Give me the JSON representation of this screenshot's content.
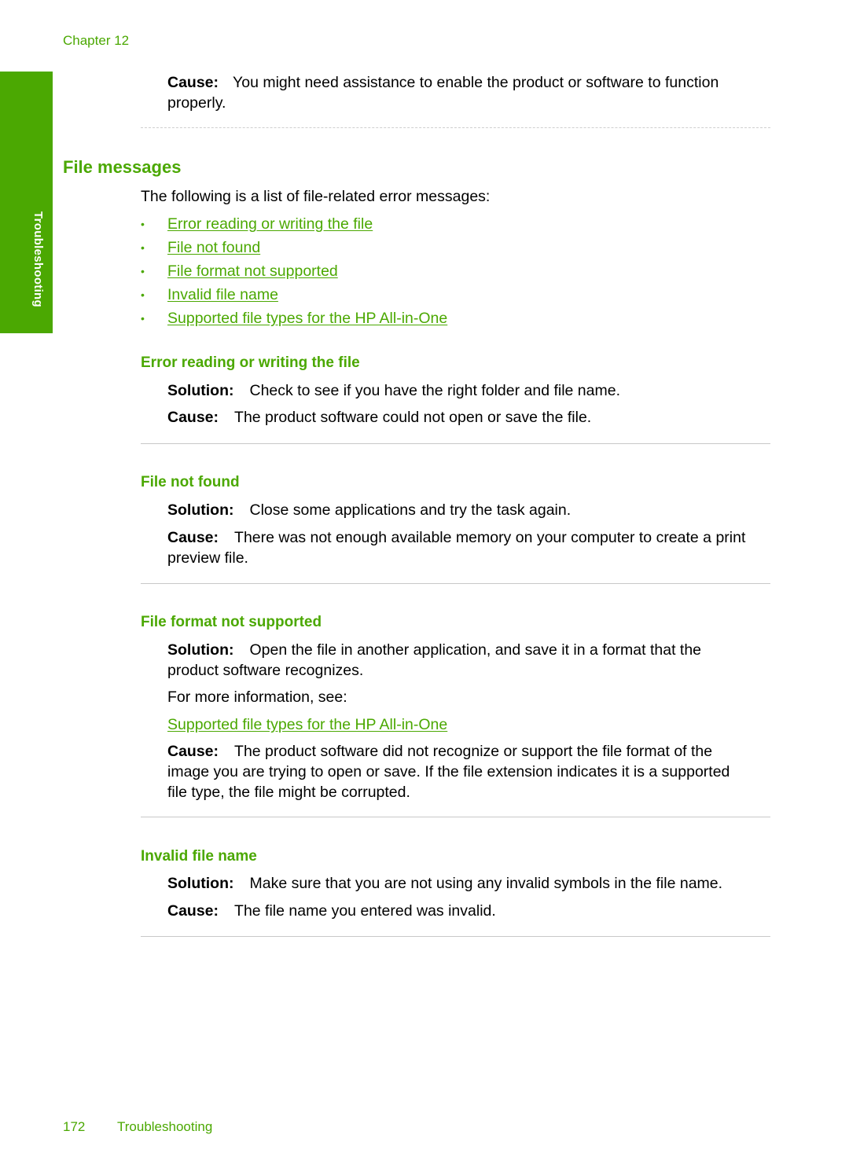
{
  "header": {
    "chapter": "Chapter 12"
  },
  "side_tab": {
    "label": "Troubleshooting"
  },
  "intro_cause": {
    "label": "Cause:",
    "text_line1": "You might need assistance to enable the product or software to function",
    "text_line2": "properly."
  },
  "section": {
    "title": "File messages",
    "intro": "The following is a list of file-related error messages:",
    "links": [
      "Error reading or writing the file",
      "File not found",
      "File format not supported",
      "Invalid file name",
      "Supported file types for the HP All-in-One"
    ]
  },
  "topics": {
    "error_rw": {
      "title": "Error reading or writing the file",
      "solution_label": "Solution:",
      "solution": "Check to see if you have the right folder and file name.",
      "cause_label": "Cause:",
      "cause": "The product software could not open or save the file."
    },
    "not_found": {
      "title": "File not found",
      "solution_label": "Solution:",
      "solution": "Close some applications and try the task again.",
      "cause_label": "Cause:",
      "cause_line1": "There was not enough available memory on your computer to create a print",
      "cause_line2": "preview file."
    },
    "format": {
      "title": "File format not supported",
      "solution_label": "Solution:",
      "solution_line1": "Open the file in another application, and save it in a format that the",
      "solution_line2": "product software recognizes.",
      "more_info": "For more information, see:",
      "more_link": "Supported file types for the HP All-in-One",
      "cause_label": "Cause:",
      "cause_line1": "The product software did not recognize or support the file format of the",
      "cause_line2": "image you are trying to open or save. If the file extension indicates it is a supported",
      "cause_line3": "file type, the file might be corrupted."
    },
    "invalid": {
      "title": "Invalid file name",
      "solution_label": "Solution:",
      "solution": "Make sure that you are not using any invalid symbols in the file name.",
      "cause_label": "Cause:",
      "cause": "The file name you entered was invalid."
    }
  },
  "footer": {
    "page_number": "172",
    "section": "Troubleshooting"
  },
  "colors": {
    "accent": "#4ba802",
    "rule": "#c8c8c8"
  }
}
